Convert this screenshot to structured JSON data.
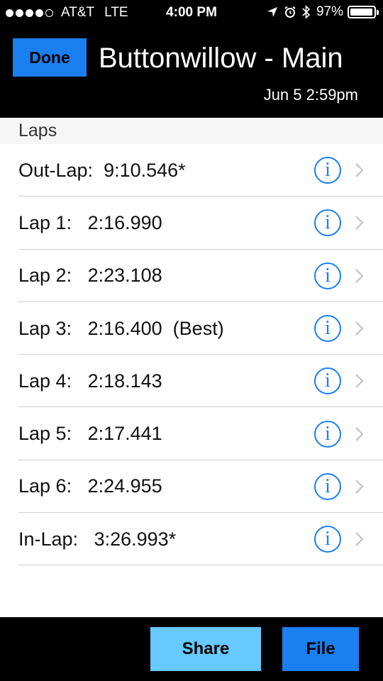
{
  "status_bar": {
    "carrier": "AT&T",
    "network": "LTE",
    "time": "4:00 PM",
    "battery_percent": "97%",
    "battery_level": 0.97,
    "signal_bars": 4,
    "icons": [
      "location-arrow-icon",
      "alarm-clock-icon",
      "bluetooth-icon"
    ]
  },
  "header": {
    "done_label": "Done",
    "title": "Buttonwillow - Main",
    "subtitle": "Jun 5 2:59pm"
  },
  "section": {
    "title": "Laps"
  },
  "laps": [
    {
      "label": "Out-Lap:  9:10.546*"
    },
    {
      "label": "Lap 1:   2:16.990"
    },
    {
      "label": "Lap 2:   2:23.108"
    },
    {
      "label": "Lap 3:   2:16.400  (Best)"
    },
    {
      "label": "Lap 4:   2:18.143"
    },
    {
      "label": "Lap 5:   2:17.441"
    },
    {
      "label": "Lap 6:   2:24.955"
    },
    {
      "label": "In-Lap:   3:26.993*"
    }
  ],
  "footer": {
    "share_label": "Share",
    "file_label": "File"
  },
  "colors": {
    "accent": "#1a7ff0",
    "share_button": "#66c9ff",
    "bars": "#000000"
  }
}
